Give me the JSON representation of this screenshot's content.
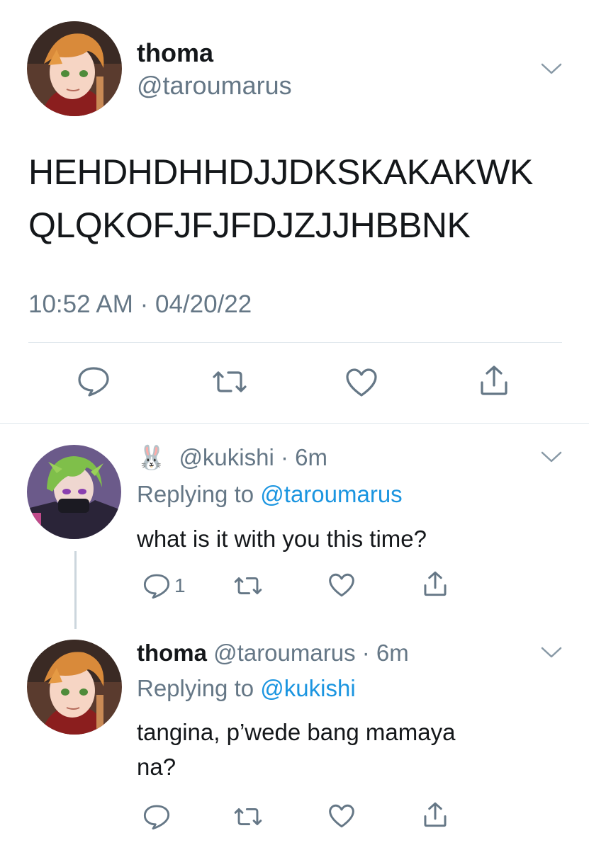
{
  "main_tweet": {
    "display_name": "thoma",
    "handle": "@taroumarus",
    "text_line1": "HEHDHDHHDJJDKSKAKAKWK",
    "text_line2": "QLQKOFJFJFDJZJJHBBNK",
    "timestamp": "10:52 AM · 04/20/22"
  },
  "reply1": {
    "emoji": "🐰",
    "handle": "@kukishi",
    "time": "· 6m",
    "replying_prefix": "Replying to",
    "replying_to": "@taroumarus",
    "text": "what is it with you this time?",
    "reply_count": "1"
  },
  "reply2": {
    "display_name": "thoma",
    "handle": "@taroumarus",
    "time": "· 6m",
    "replying_prefix": "Replying to",
    "replying_to": "@kukishi",
    "text_line1": "tangina, p’wede bang mamaya",
    "text_line2": "na?"
  },
  "colors": {
    "icon": "#657786",
    "link": "#1b95e0",
    "divider": "#e1e8ed",
    "thread_line": "#ccd6dd"
  },
  "icons": [
    "chevron-down-icon",
    "reply-icon",
    "retweet-icon",
    "like-icon",
    "share-icon"
  ]
}
